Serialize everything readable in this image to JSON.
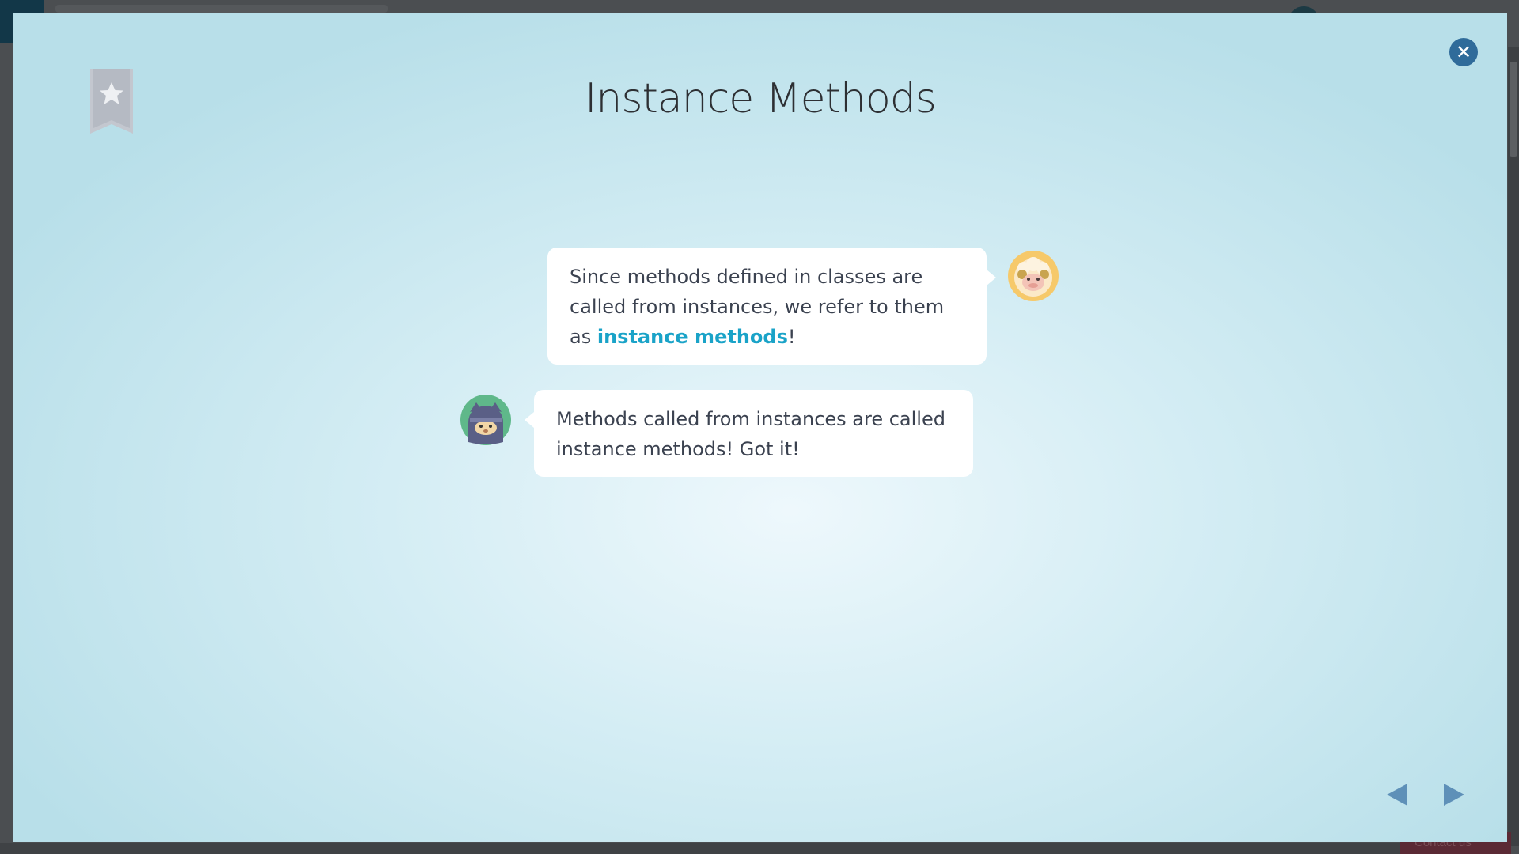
{
  "background": {
    "contact_label": "Contact us"
  },
  "lesson": {
    "title": "Instance Methods"
  },
  "dialogue": [
    {
      "speaker": "sheep",
      "line_1": "Since methods defined in classes are called from instances, we refer to them as ",
      "highlight": "instance methods",
      "suffix": "!"
    },
    {
      "speaker": "ninja",
      "text": "Methods called from instances are called instance methods! Got it!"
    }
  ],
  "colors": {
    "accent": "#1aa3c8",
    "close_button": "#2f6b9a",
    "nav_arrow": "#5e90b8",
    "text": "#3b4250"
  },
  "icons": {
    "bookmark": "bookmark-star-icon",
    "close": "close-icon",
    "prev": "prev-arrow-icon",
    "next": "next-arrow-icon"
  }
}
